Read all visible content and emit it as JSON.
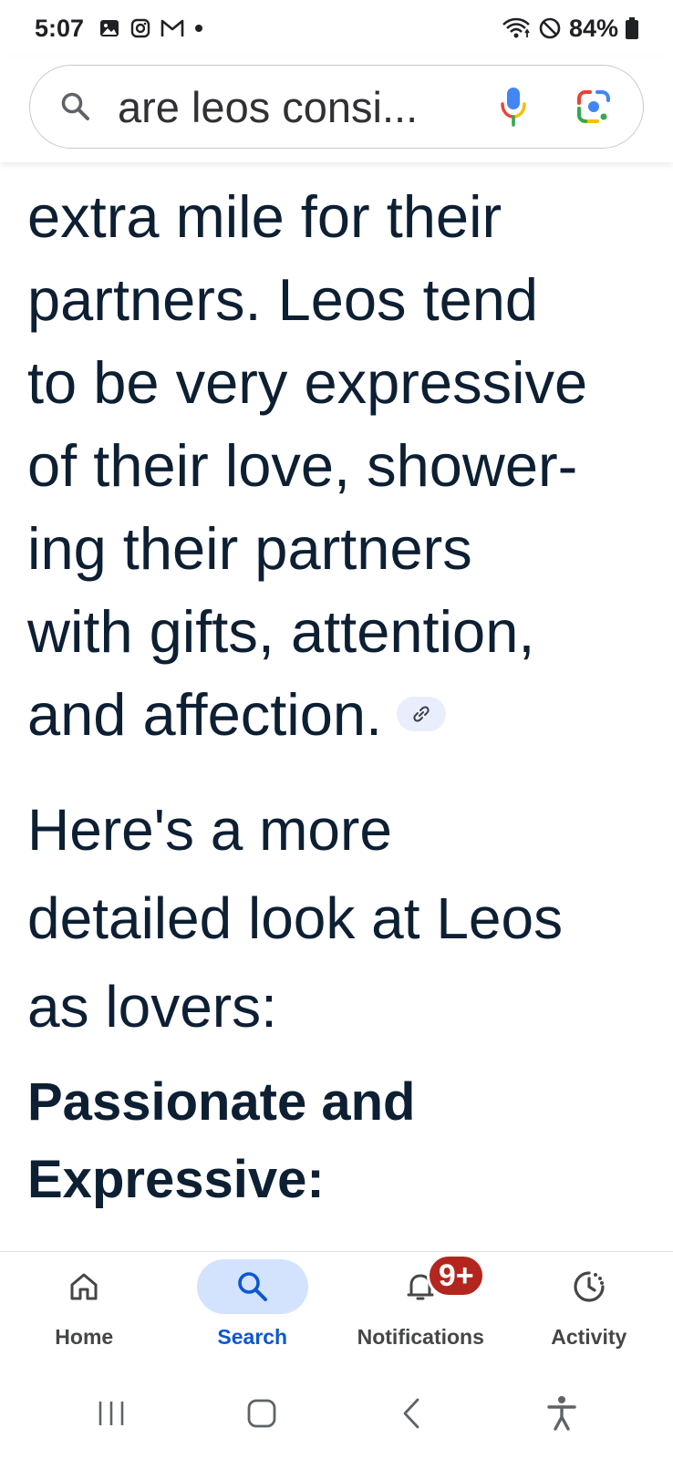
{
  "status_bar": {
    "time": "5:07",
    "battery": "84%",
    "notification_icons": [
      "gallery-icon",
      "instagram-icon",
      "gmail-icon",
      "dot-icon"
    ],
    "system_icons": [
      "wifi-icon",
      "do-not-disturb-icon",
      "battery-icon"
    ]
  },
  "search": {
    "query": "are leos consi..."
  },
  "content": {
    "paragraph_lines": [
      "extra mile for their",
      "partners. Leos tend",
      "to be very expressive",
      "of their love, shower-",
      "ing their partners",
      "with gifts, attention,",
      "and affection."
    ],
    "section_heading_lines": [
      "Here's a more",
      "detailed look at Leos",
      "as lovers:"
    ],
    "subheading_lines": [
      "Passionate and",
      "Expressive:"
    ]
  },
  "bottom_nav": {
    "items": [
      {
        "label": "Home",
        "icon": "home-icon",
        "active": false
      },
      {
        "label": "Search",
        "icon": "search-icon",
        "active": true
      },
      {
        "label": "Notifications",
        "icon": "bell-icon",
        "active": false,
        "badge": "9+"
      },
      {
        "label": "Activity",
        "icon": "activity-icon",
        "active": false
      }
    ]
  },
  "colors": {
    "text": "#0d1f33",
    "active_nav": "#0b57d0",
    "active_pill": "#d3e3fd",
    "badge": "#b3261e",
    "link_chip": "#e8eefc"
  }
}
